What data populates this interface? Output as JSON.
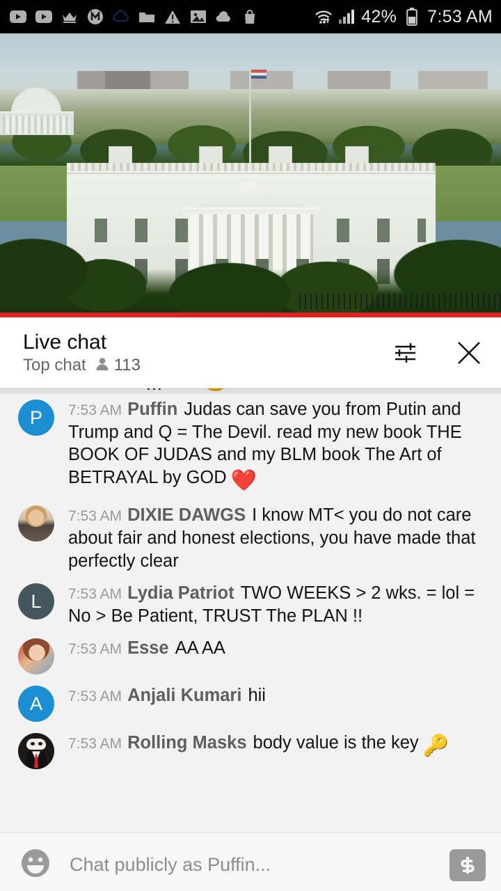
{
  "status_bar": {
    "icons_left": [
      "youtube-icon",
      "youtube-icon-2",
      "crown-icon",
      "m-circle-icon",
      "cloud-outline-icon",
      "folder-icon",
      "warning-triangle-icon",
      "image-icon",
      "cloud-filled-icon",
      "shopping-bag-icon"
    ],
    "wifi_icon": "wifi-icon",
    "signal_icon": "signal-bars-icon",
    "battery_percent": "42%",
    "battery_icon": "battery-icon",
    "time": "7:53 AM"
  },
  "video": {
    "description": "white-house-live-stream",
    "progress_color": "#e02020"
  },
  "chat_header": {
    "title": "Live chat",
    "subtitle": "Top chat",
    "viewer_icon": "person-icon",
    "viewer_count": "113",
    "settings_icon": "sliders-icon",
    "close_icon": "close-icon"
  },
  "clipped_message": {
    "text": "...",
    "emoji": "emoji-partial"
  },
  "messages": [
    {
      "time": "7:53 AM",
      "author": "Puffin",
      "text": "Judas can save you from Putin and Trump and Q = The Devil. read my new book THE BOOK OF JUDAS and my BLM book The Art of BETRAYAL by GOD",
      "emoji": "❤️",
      "avatar_type": "letter",
      "avatar_letter": "P",
      "avatar_color": "#1b8fd1"
    },
    {
      "time": "7:53 AM",
      "author": "DIXIE DAWGS",
      "text": "I know MT< you do not care about fair and honest elections, you have made that perfectly clear",
      "emoji": "",
      "avatar_type": "photo-dixie",
      "avatar_letter": "",
      "avatar_color": "#d9bfa6"
    },
    {
      "time": "7:53 AM",
      "author": "Lydia Patriot",
      "text": "TWO WEEKS > 2 wks. = lol = No > Be Patient, TRUST The PLAN !!",
      "emoji": "",
      "avatar_type": "letter",
      "avatar_letter": "L",
      "avatar_color": "#46565e"
    },
    {
      "time": "7:53 AM",
      "author": "Esse",
      "text": "AA AA",
      "emoji": "",
      "avatar_type": "photo-esse",
      "avatar_letter": "",
      "avatar_color": "#b7452a"
    },
    {
      "time": "7:53 AM",
      "author": "Anjali Kumari",
      "text": "hii",
      "emoji": "",
      "avatar_type": "letter",
      "avatar_letter": "A",
      "avatar_color": "#1b8fd1"
    },
    {
      "time": "7:53 AM",
      "author": "Rolling Masks",
      "text": "body value is the key",
      "emoji": "🔑",
      "avatar_type": "masks",
      "avatar_letter": "",
      "avatar_color": "#1c1a19"
    }
  ],
  "composer": {
    "emoji_icon": "emoji-smiley-icon",
    "placeholder": "Chat publicly as Puffin...",
    "value": "",
    "superchat_icon": "dollar-icon"
  }
}
